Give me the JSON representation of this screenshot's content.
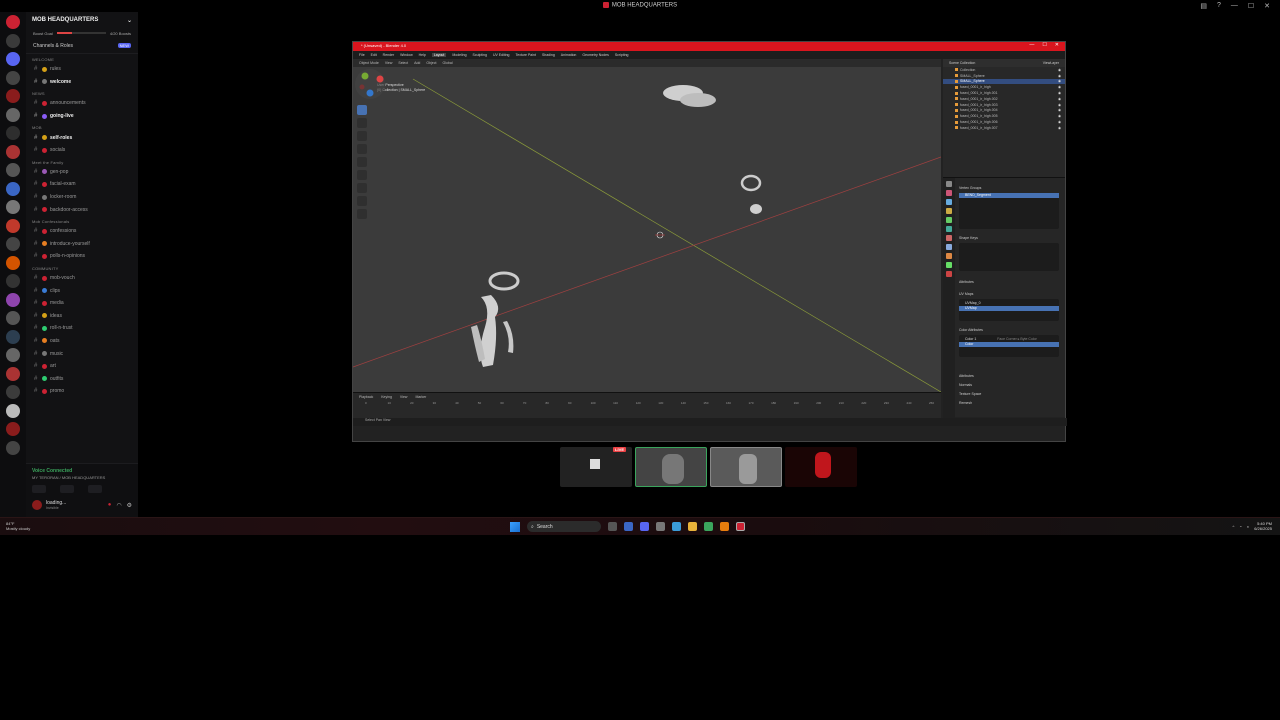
{
  "app": {
    "title": "MOB HEADQUARTERS"
  },
  "discord": {
    "server_name": "MOB HEADQUARTERS",
    "boost": {
      "goal_label": "Boost Goal",
      "count_label": "4/20 Boosts",
      "progress": 0.3
    },
    "channels_roles_label": "Channels & Roles",
    "new_badge": "NEW",
    "categories": [
      {
        "name": "WELCOME",
        "channels": [
          {
            "name": "rules",
            "bold": false,
            "color": "#d4a017"
          },
          {
            "name": "welcome",
            "bold": true,
            "color": "#777"
          }
        ]
      },
      {
        "name": "NEWS",
        "channels": [
          {
            "name": "announcements",
            "bold": false,
            "color": "#c23"
          },
          {
            "name": "going-live",
            "bold": true,
            "color": "#8a5cf6"
          }
        ]
      },
      {
        "name": "MOB",
        "channels": [
          {
            "name": "self-roles",
            "bold": true,
            "color": "#d4a017"
          },
          {
            "name": "socials",
            "bold": false,
            "color": "#c23"
          }
        ]
      },
      {
        "name": "Meet the Family",
        "channels": [
          {
            "name": "gen-pop",
            "bold": false,
            "color": "#9b59b6"
          },
          {
            "name": "facial-exam",
            "bold": false,
            "color": "#c23"
          },
          {
            "name": "locker-room",
            "bold": false,
            "color": "#777"
          },
          {
            "name": "backdoor-access",
            "bold": false,
            "color": "#c23"
          }
        ]
      },
      {
        "name": "Mob Confessionals",
        "channels": [
          {
            "name": "confessions",
            "bold": false,
            "color": "#c23"
          },
          {
            "name": "introduce-yourself",
            "bold": false,
            "color": "#e67e22"
          },
          {
            "name": "polls-n-opinions",
            "bold": false,
            "color": "#c23"
          }
        ]
      },
      {
        "name": "COMMUNITY",
        "channels": [
          {
            "name": "mob-vouch",
            "bold": false,
            "color": "#c23"
          },
          {
            "name": "clips",
            "bold": false,
            "color": "#3a7bd5"
          },
          {
            "name": "media",
            "bold": false,
            "color": "#c23"
          },
          {
            "name": "ideas",
            "bold": false,
            "color": "#d4a017"
          },
          {
            "name": "roll-n-trust",
            "bold": false,
            "color": "#2ecc71"
          },
          {
            "name": "oats",
            "bold": false,
            "color": "#e67e22"
          },
          {
            "name": "music",
            "bold": false,
            "color": "#777"
          },
          {
            "name": "art",
            "bold": false,
            "color": "#c23"
          },
          {
            "name": "outfits",
            "bold": false,
            "color": "#2ecc71"
          },
          {
            "name": "promo",
            "bold": false,
            "color": "#c23"
          }
        ]
      }
    ],
    "voice": {
      "status": "Voice Connected",
      "channel": "MY TERORAN / MOB HEADQUARTERS"
    },
    "user": {
      "name": "loading...",
      "status": "Invisible"
    }
  },
  "blender": {
    "window_title": "* (Unsaved) - Blender 4.0",
    "menu": [
      "File",
      "Edit",
      "Render",
      "Window",
      "Help",
      "Layout",
      "Modeling",
      "Sculpting",
      "UV Editing",
      "Texture Paint",
      "Shading",
      "Animation",
      "Geometry Nodes",
      "Scripting"
    ],
    "active_menu": "Layout",
    "viewport_header": [
      "Object Mode",
      "View",
      "Select",
      "Add",
      "Object",
      "Global"
    ],
    "view_label_1": "User Perspective",
    "view_label_2": "(0) Collection | SMALL_Sphere",
    "outliner": {
      "title": "Scene Collection",
      "view_layer": "ViewLayer",
      "rows": [
        "Collection",
        "SMALL_Sphere",
        "SMALL_Sphere",
        "fused_0001_ir_high",
        "fused_0001_ir_high.001",
        "fused_0001_ir_high.002",
        "fused_0001_ir_high.003",
        "fused_0001_ir_high.004",
        "fused_0001_ir_high.005",
        "fused_0001_ir_high.006",
        "fused_0001_ir_high.007"
      ],
      "selected_index": 2
    },
    "properties": {
      "vertex_groups_label": "Vertex Groups",
      "vertex_group_item": "BEND_Segment",
      "shape_keys_label": "Shape Keys",
      "attributes_label": "Attributes",
      "uv_maps_label": "UV Maps",
      "uv_items": [
        "UVMap_0",
        "UVMap"
      ],
      "color_attributes_label": "Color Attributes",
      "color_items": [
        "Color 1",
        "Color"
      ],
      "color_items_desc": "Face Corner ▸ Byte Color",
      "extra_sections": [
        "Attributes",
        "Normals",
        "Texture Space",
        "Remesh"
      ]
    },
    "timeline": {
      "header": [
        "Playback",
        "Keying",
        "View",
        "Marker"
      ],
      "start": "1",
      "end": "250",
      "ticks": [
        "0",
        "10",
        "20",
        "30",
        "40",
        "50",
        "60",
        "70",
        "80",
        "90",
        "100",
        "110",
        "120",
        "130",
        "140",
        "150",
        "160",
        "170",
        "180",
        "190",
        "200",
        "210",
        "220",
        "230",
        "240",
        "250"
      ]
    },
    "status": "Select    Pan View"
  },
  "thumbs": {
    "live_label": "LIVE"
  },
  "taskbar": {
    "weather_temp": "84°F",
    "weather_desc": "Mostly cloudy",
    "search_label": "Search",
    "time": "5:40 PM",
    "date": "6/26/2025"
  }
}
